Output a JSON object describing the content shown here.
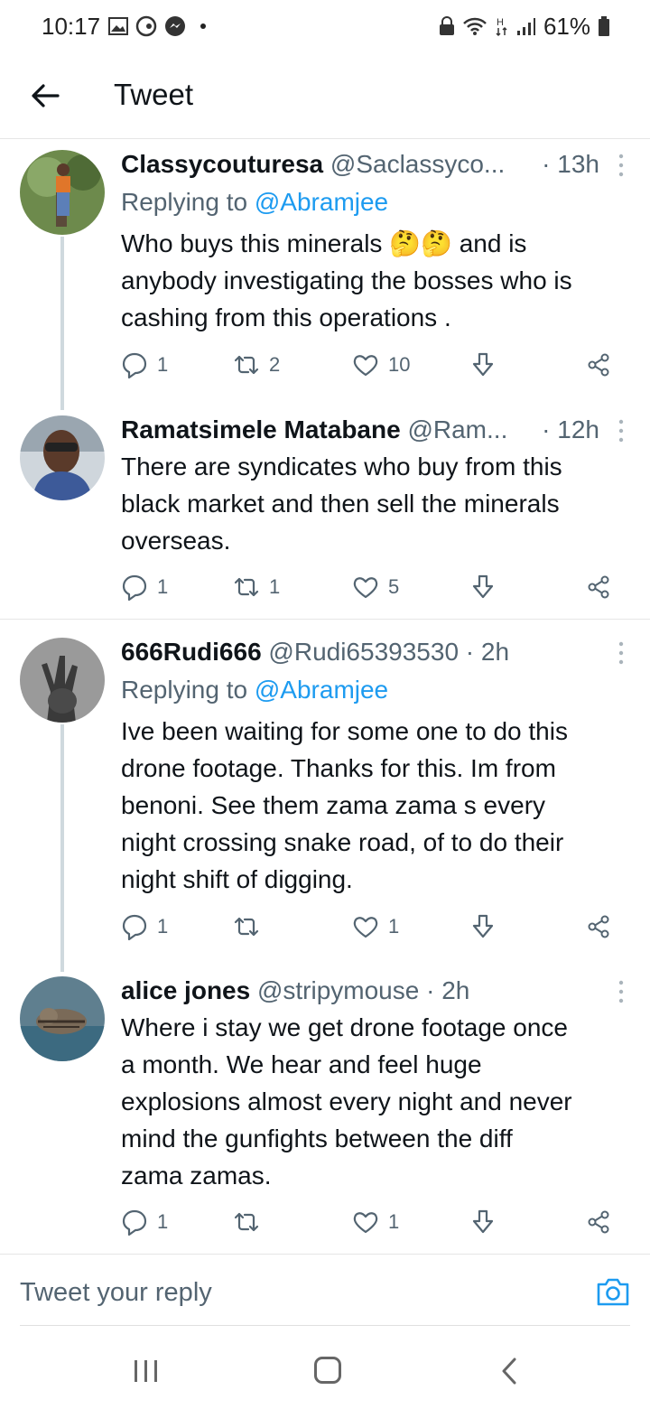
{
  "status_bar": {
    "time": "10:17",
    "battery": "61%"
  },
  "header": {
    "title": "Tweet"
  },
  "tweets": [
    {
      "name": "Classycouturesa",
      "handle": "@Saclassyco...",
      "time": "· 13h",
      "replying_prefix": "Replying to ",
      "replying_to": "@Abramjee",
      "text": "Who buys this minerals 🤔🤔 and is\nanybody investigating the bosses who is\ncashing from this operations .",
      "replies": "1",
      "retweets": "2",
      "likes": "10"
    },
    {
      "name": "Ramatsimele Matabane",
      "handle": "@Ram...",
      "time": "· 12h",
      "text": "There are syndicates who buy from this\nblack market and then sell the minerals\noverseas.",
      "replies": "1",
      "retweets": "1",
      "likes": "5"
    },
    {
      "name": "666Rudi666",
      "handle": "@Rudi65393530",
      "time": "· 2h",
      "replying_prefix": "Replying to ",
      "replying_to": "@Abramjee",
      "text": "Ive been waiting for some one to do this\ndrone footage. Thanks for this. Im from\nbenoni. See them zama zama s every\nnight crossing snake road, of to do their\nnight shift of digging.",
      "replies": "1",
      "retweets": "",
      "likes": "1"
    },
    {
      "name": "alice jones",
      "handle": "@stripymouse",
      "time": "· 2h",
      "text": "Where i stay we get drone footage once\na month. We hear and feel huge\nexplosions almost every night and never\nmind the gunfights between the diff\nzama zamas.",
      "replies": "1",
      "retweets": "",
      "likes": "1"
    }
  ],
  "reply_bar": {
    "placeholder": "Tweet your reply"
  },
  "colors": {
    "accent": "#1d9bf0",
    "secondary_text": "#536471",
    "thread_line": "#cfd9de"
  }
}
